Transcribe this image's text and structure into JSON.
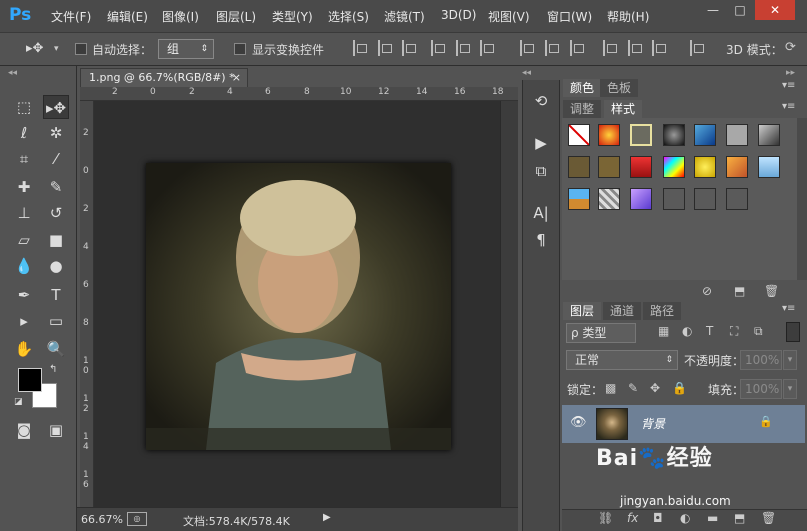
{
  "app": {
    "logo": "Ps",
    "menu": [
      "文件(F)",
      "编辑(E)",
      "图像(I)",
      "图层(L)",
      "类型(Y)",
      "选择(S)",
      "滤镜(T)",
      "3D(D)",
      "视图(V)",
      "窗口(W)",
      "帮助(H)"
    ],
    "window_controls": {
      "minimize": "—",
      "maximize": "□",
      "close": "✕"
    }
  },
  "options_bar": {
    "auto_select_label": "自动选择：",
    "auto_select_value": "组",
    "show_transform_label": "显示变换控件",
    "mode_label": "3D 模式："
  },
  "document": {
    "tab_title": "1.png @ 66.7%(RGB/8#) *",
    "tab_close": "×",
    "ruler_top_ticks": [
      "2",
      "0",
      "2",
      "4",
      "6",
      "8",
      "10",
      "12",
      "14",
      "16",
      "18"
    ],
    "ruler_left_ticks": [
      "2",
      "0",
      "2",
      "4",
      "6",
      "8",
      "1 0",
      "1 2",
      "1 4",
      "1 6"
    ],
    "zoom": "66.67%",
    "doc_size": "文档:578.4K/578.4K"
  },
  "tools": {
    "foreground_color": "#000000",
    "background_color": "#ffffff"
  },
  "panels": {
    "top_tabs_row1": [
      "颜色",
      "色板"
    ],
    "top_tabs_row2": [
      "调整",
      "样式"
    ],
    "layer_tabs": [
      "图层",
      "通道",
      "路径"
    ],
    "layer_filter": "ρ 类型",
    "blend_mode": "正常",
    "opacity_label": "不透明度：",
    "opacity_value": "100%",
    "lock_label": "锁定：",
    "fill_label": "填充：",
    "fill_value": "100%",
    "layer_name": "背景"
  },
  "watermark": {
    "brand": "Bai",
    "brand_cn": "经验",
    "url": "jingyan.baidu.com"
  }
}
